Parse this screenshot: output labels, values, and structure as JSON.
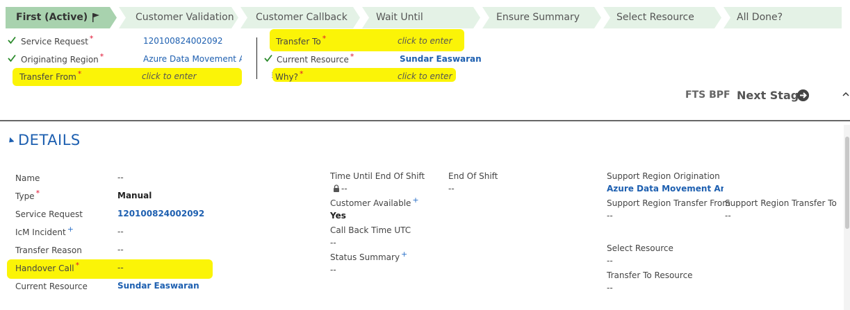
{
  "stages": [
    {
      "label": "First (Active)",
      "active": true
    },
    {
      "label": "Customer Validation"
    },
    {
      "label": "Customer Callback"
    },
    {
      "label": "Wait Until"
    },
    {
      "label": "Ensure Summary"
    },
    {
      "label": "Select Resource"
    },
    {
      "label": "All Done?"
    }
  ],
  "process": {
    "service_request": {
      "label": "Service Request",
      "value": "120100824002092"
    },
    "originating_region": {
      "label": "Originating Region",
      "value": "Azure Data Movement An"
    },
    "transfer_from": {
      "label": "Transfer From",
      "value": "click to enter"
    },
    "transfer_to": {
      "label": "Transfer To",
      "value": "click to enter"
    },
    "current_resource": {
      "label": "Current Resource",
      "value": "Sundar Easwaran"
    },
    "why": {
      "label": "Why?",
      "value": "click to enter"
    },
    "required_mark": "*",
    "bpf_name": "FTS BPF",
    "next_stage": "Next Stage"
  },
  "details": {
    "title": "DETAILS",
    "col1": [
      {
        "label": "Name",
        "value": "--",
        "style": "plain"
      },
      {
        "label": "Type",
        "value": "Manual",
        "style": "bold",
        "mark": "*"
      },
      {
        "label": "Service Request",
        "value": "120100824002092",
        "style": "link"
      },
      {
        "label": "IcM Incident",
        "value": "--",
        "style": "plain",
        "mark": "+"
      },
      {
        "label": "Transfer Reason",
        "value": "--",
        "style": "plain"
      },
      {
        "label": "Handover Call",
        "value": "--",
        "style": "plain",
        "mark": "*"
      },
      {
        "label": "Current Resource",
        "value": "Sundar Easwaran",
        "style": "link"
      }
    ],
    "col2": {
      "time_until_end": {
        "label": "Time Until End Of Shift",
        "value": "--"
      },
      "end_of_shift": {
        "label": "End Of Shift",
        "value": "--"
      },
      "customer_available": {
        "label": "Customer Available",
        "value": "Yes",
        "mark": "+"
      },
      "call_back_time": {
        "label": "Call Back Time UTC",
        "value": "--"
      },
      "status_summary": {
        "label": "Status Summary",
        "value": "--",
        "mark": "+"
      }
    },
    "col3": {
      "support_region_origination": {
        "label": "Support Region Origination",
        "value": "Azure Data Movement An"
      },
      "transfer_from": {
        "label": "Support Region Transfer From",
        "value": "--"
      },
      "transfer_to": {
        "label": "Support Region Transfer To",
        "value": "--"
      },
      "select_resource": {
        "label": "Select Resource",
        "value": "--"
      },
      "transfer_to_resource": {
        "label": "Transfer To Resource",
        "value": "--"
      }
    }
  },
  "colors": {
    "highlight": "#fbf407",
    "active_stage": "#a8d2ae",
    "stage": "#e4f2e6",
    "link": "#1d5fb0",
    "required": "#e0102f",
    "recommended": "#2a70c8"
  }
}
